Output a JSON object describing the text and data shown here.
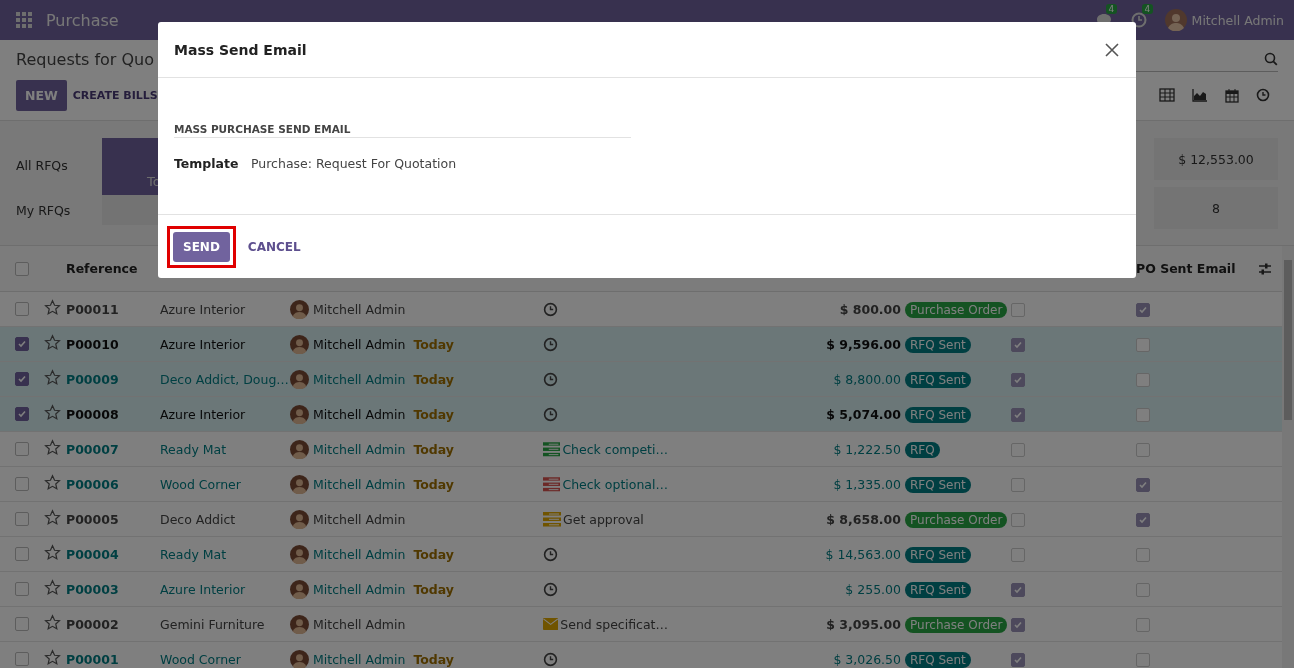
{
  "navbar": {
    "app_name": "Purchase",
    "messages_count": "4",
    "activities_count": "4",
    "user": "Mitchell Admin"
  },
  "control_panel": {
    "title": "Requests for Quo",
    "buttons": [
      "NEW",
      "CREATE BILLS"
    ]
  },
  "dashboard": {
    "row_labels": [
      "All RFQs",
      "My RFQs"
    ],
    "tile_label": "To",
    "total": "$ 12,553.00",
    "count": "8"
  },
  "table": {
    "all_selected": false,
    "columns": [
      "Reference",
      "PO Sent Email"
    ],
    "rows": [
      {
        "selected": false,
        "kind": "plain",
        "reference": "P00011",
        "vendor": "Azure Interior",
        "buyer": "Mitchell Admin",
        "deadline": "",
        "activity": {
          "kind": "clock"
        },
        "total": "$ 800.00",
        "status": {
          "kind": "purchase_order",
          "label": "Purchase Order"
        },
        "column_9": false,
        "po_sent_email": true
      },
      {
        "selected": true,
        "kind": "strong",
        "reference": "P00010",
        "vendor": "Azure Interior",
        "buyer": "Mitchell Admin",
        "deadline": "Today",
        "activity": {
          "kind": "clock"
        },
        "total": "$ 9,596.00",
        "status": {
          "kind": "rfq_sent",
          "label": "RFQ Sent"
        },
        "column_9": true,
        "po_sent_email": false
      },
      {
        "selected": true,
        "kind": "info",
        "reference": "P00009",
        "vendor": "Deco Addict, Doug…",
        "buyer": "Mitchell Admin",
        "deadline": "Today",
        "activity": {
          "kind": "clock"
        },
        "total": "$ 8,800.00",
        "status": {
          "kind": "rfq_sent",
          "label": "RFQ Sent"
        },
        "column_9": true,
        "po_sent_email": false
      },
      {
        "selected": true,
        "kind": "strong",
        "reference": "P00008",
        "vendor": "Azure Interior",
        "buyer": "Mitchell Admin",
        "deadline": "Today",
        "activity": {
          "kind": "clock"
        },
        "total": "$ 5,074.00",
        "status": {
          "kind": "rfq_sent",
          "label": "RFQ Sent"
        },
        "column_9": true,
        "po_sent_email": false
      },
      {
        "selected": false,
        "kind": "info",
        "reference": "P00007",
        "vendor": "Ready Mat",
        "buyer": "Mitchell Admin",
        "deadline": "Today",
        "activity": {
          "kind": "todo_planned",
          "text": "Check competi…"
        },
        "total": "$ 1,222.50",
        "status": {
          "kind": "rfq",
          "label": "RFQ"
        },
        "column_9": false,
        "po_sent_email": false
      },
      {
        "selected": false,
        "kind": "info",
        "reference": "P00006",
        "vendor": "Wood Corner",
        "buyer": "Mitchell Admin",
        "deadline": "Today",
        "activity": {
          "kind": "todo_overdue",
          "text": "Check optional…"
        },
        "total": "$ 1,335.00",
        "status": {
          "kind": "rfq_sent",
          "label": "RFQ Sent"
        },
        "column_9": false,
        "po_sent_email": true
      },
      {
        "selected": false,
        "kind": "plain",
        "reference": "P00005",
        "vendor": "Deco Addict",
        "buyer": "Mitchell Admin",
        "deadline": "",
        "activity": {
          "kind": "todo_today",
          "text": "Get approval"
        },
        "total": "$ 8,658.00",
        "status": {
          "kind": "purchase_order",
          "label": "Purchase Order"
        },
        "column_9": false,
        "po_sent_email": true
      },
      {
        "selected": false,
        "kind": "info",
        "reference": "P00004",
        "vendor": "Ready Mat",
        "buyer": "Mitchell Admin",
        "deadline": "Today",
        "activity": {
          "kind": "clock"
        },
        "total": "$ 14,563.00",
        "status": {
          "kind": "rfq_sent",
          "label": "RFQ Sent"
        },
        "column_9": false,
        "po_sent_email": false
      },
      {
        "selected": false,
        "kind": "info",
        "reference": "P00003",
        "vendor": "Azure Interior",
        "buyer": "Mitchell Admin",
        "deadline": "Today",
        "activity": {
          "kind": "clock"
        },
        "total": "$ 255.00",
        "status": {
          "kind": "rfq_sent",
          "label": "RFQ Sent"
        },
        "column_9": true,
        "po_sent_email": false
      },
      {
        "selected": false,
        "kind": "plain",
        "reference": "P00002",
        "vendor": "Gemini Furniture",
        "buyer": "Mitchell Admin",
        "deadline": "",
        "activity": {
          "kind": "email",
          "text": "Send specificat…"
        },
        "total": "$ 3,095.00",
        "status": {
          "kind": "purchase_order",
          "label": "Purchase Order"
        },
        "column_9": true,
        "po_sent_email": false
      },
      {
        "selected": false,
        "kind": "info",
        "reference": "P00001",
        "vendor": "Wood Corner",
        "buyer": "Mitchell Admin",
        "deadline": "Today",
        "activity": {
          "kind": "clock"
        },
        "total": "$ 3,026.50",
        "status": {
          "kind": "rfq_sent",
          "label": "RFQ Sent"
        },
        "column_9": true,
        "po_sent_email": false
      }
    ]
  },
  "dialog": {
    "title": "Mass Send Email",
    "section": "MASS PURCHASE SEND EMAIL",
    "field_label": "Template",
    "field_value": "Purchase: Request For Quotation",
    "send": "SEND",
    "send_highlighted": true,
    "cancel": "CANCEL"
  }
}
